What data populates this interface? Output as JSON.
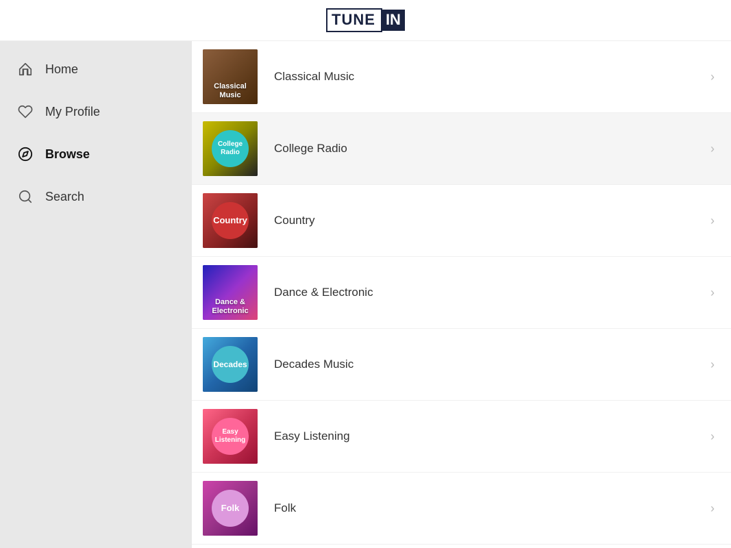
{
  "header": {
    "logo_tune": "TUNE",
    "logo_in": "IN"
  },
  "sidebar": {
    "items": [
      {
        "id": "home",
        "label": "Home",
        "icon": "home-icon",
        "active": false
      },
      {
        "id": "my-profile",
        "label": "My Profile",
        "icon": "heart-icon",
        "active": false
      },
      {
        "id": "browse",
        "label": "Browse",
        "icon": "compass-icon",
        "active": true
      },
      {
        "id": "search",
        "label": "Search",
        "icon": "search-icon",
        "active": false
      }
    ]
  },
  "content": {
    "items": [
      {
        "id": "classical-music",
        "label": "Classical Music",
        "thumb_style": "classical",
        "thumb_text": "Classical\nMusic",
        "highlighted": false
      },
      {
        "id": "college-radio",
        "label": "College Radio",
        "thumb_style": "college",
        "thumb_text": "College\nRadio",
        "highlighted": true
      },
      {
        "id": "country",
        "label": "Country",
        "thumb_style": "country",
        "thumb_text": "Country",
        "highlighted": false
      },
      {
        "id": "dance-electronic",
        "label": "Dance & Electronic",
        "thumb_style": "dance",
        "thumb_text": "Dance &\nElectronic",
        "highlighted": false
      },
      {
        "id": "decades-music",
        "label": "Decades Music",
        "thumb_style": "decades",
        "thumb_text": "Decades",
        "highlighted": false
      },
      {
        "id": "easy-listening",
        "label": "Easy Listening",
        "thumb_style": "easy",
        "thumb_text": "Easy\nListening",
        "highlighted": false
      },
      {
        "id": "folk",
        "label": "Folk",
        "thumb_style": "folk",
        "thumb_text": "Folk",
        "highlighted": false
      }
    ],
    "chevron": "›"
  }
}
